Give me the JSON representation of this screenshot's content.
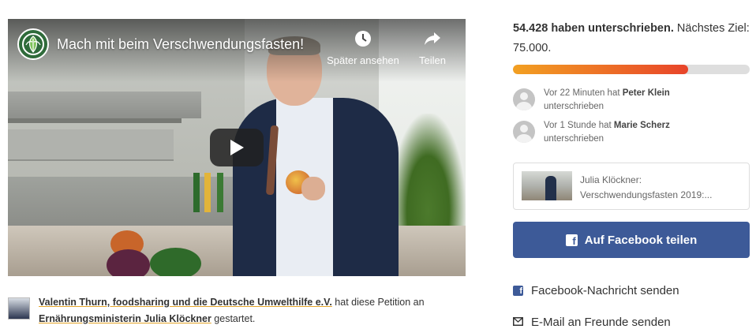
{
  "video": {
    "title": "Mach mit beim Verschwendungsfasten!",
    "watch_later_label": "Später ansehen",
    "share_label": "Teilen"
  },
  "petition": {
    "starter_names": "Valentin Thurn, foodsharing und die Deutsche Umwelthilfe e.V.",
    "starter_mid": " hat diese Petition an ",
    "recipient": "Ernährungsministerin Julia Klöckner",
    "starter_end": " gestartet."
  },
  "signatures": {
    "count_text": "54.428 haben unterschrieben.",
    "next_goal_text": " Nächstes Ziel: 75.000.",
    "count": 54428,
    "goal": 75000,
    "progress_fraction": 0.74
  },
  "activity": [
    {
      "prefix": "Vor 22 Minuten hat ",
      "name": "Peter Klein",
      "suffix": " unterschrieben"
    },
    {
      "prefix": "Vor 1 Stunde hat ",
      "name": "Marie Scherz",
      "suffix": " unterschrieben"
    }
  ],
  "related": {
    "title_line1": "Julia Klöckner:",
    "title_line2": "Verschwendungsfasten 2019:..."
  },
  "share": {
    "facebook_button": "Auf Facebook teilen",
    "facebook_message": "Facebook-Nachricht senden",
    "email_friends": "E-Mail an Freunde senden"
  },
  "colors": {
    "facebook": "#3d5a98",
    "progress_start": "#f2a022",
    "progress_end": "#e8442a",
    "link_underline": "#e5a62a"
  },
  "icons": [
    "channel-logo-icon",
    "clock-icon",
    "share-arrow-icon",
    "play-icon",
    "facebook-icon",
    "envelope-icon"
  ]
}
